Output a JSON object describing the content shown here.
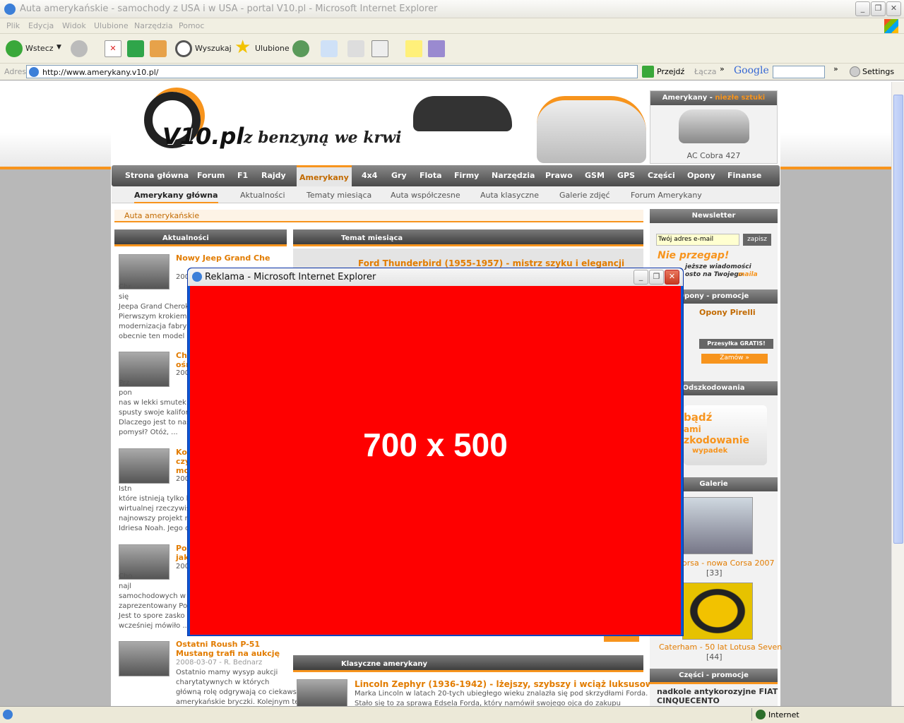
{
  "window": {
    "title": "Auta amerykańskie - samochody z USA i w USA - portal V10.pl - Microsoft Internet Explorer"
  },
  "menu": [
    "Plik",
    "Edycja",
    "Widok",
    "Ulubione",
    "Narzędzia",
    "Pomoc"
  ],
  "toolbar": {
    "back": "Wstecz",
    "search": "Wyszukaj",
    "favorites": "Ulubione"
  },
  "address": {
    "label": "Adres",
    "url": "http://www.amerykany.v10.pl/",
    "go": "Przejdź",
    "links": "Łącza",
    "google": "Google",
    "settings": "Settings"
  },
  "site": {
    "logo": "V10.pl",
    "slogan": "z benzyną we krwi",
    "promo": {
      "title": "Amerykany",
      "title_suffix": "niezłe sztuki",
      "caption": "AC Cobra 427"
    },
    "nav": [
      "Strona główna",
      "Forum",
      "F1",
      "Rajdy",
      "Amerykany",
      "4x4",
      "Gry",
      "Flota",
      "Firmy",
      "Narzędzia",
      "Prawo",
      "GSM",
      "GPS",
      "Części",
      "Opony",
      "Finanse"
    ],
    "subnav": [
      "Amerykany główna",
      "Aktualności",
      "Tematy miesiąca",
      "Auta współczesne",
      "Auta klasyczne",
      "Galerie zdjęć",
      "Forum Amerykany"
    ],
    "breadcrumb": "Auta amerykańskie",
    "news": {
      "header": "Aktualności",
      "items": [
        {
          "title": "Nowy Jeep Grand Che",
          "date": "200",
          "text": "Chr\nsię\nJeepa Grand Cherok\nPierwszym krokiem k\nmodernizacja fabryk\nobecnie ten model o"
        },
        {
          "title": "Ch\nośn",
          "date": "200",
          "text": "Prz\npon\nnas w lekki smutek. C\nspusty swoje kalifor\nDlaczego jest to nas\npomysł? Otóż, ..."
        },
        {
          "title": "Kon\nczy\nmo",
          "date": "200",
          "text": "Istn\nktóre istnieją tylko b\nwirtualnej rzeczywis\nnajnowszy projekt n\nIdriesa Noah. Jego c"
        },
        {
          "title": "Pon\njak",
          "date": "200",
          "text": "Cho\nnajl\nsamochodowych w N\nzaprezentowany Pon\nJest to spore zasko\nwcześniej mówiło ..."
        },
        {
          "title": "Ostatni Roush P-51\nMustang trafi na aukcję",
          "date": "2008-03-07 - R. Bednarz",
          "text": "Ostatnio mamy wysyp aukcji\ncharytatywnych w których\ngłówną rolę odgrywają co ciekawsze\namerykańskie bryczki. Kolejnym tego"
        }
      ]
    },
    "topic": {
      "header": "Temat miesiąca",
      "title": "Ford Thunderbird (1955-1957) - mistrz szyku i elegancji"
    },
    "classic": {
      "header": "Klasyczne amerykany",
      "title": "Lincoln Zephyr (1936-1942) - lżejszy, szybszy i wciąż luksusowy",
      "text": "Marka Lincoln w latach 20-tych ubiegłego wieku znalazła się pod skrzydłami Forda.\nStało się to za sprawą Edsela Forda, który namówił swojego ojca do zakupu"
    },
    "newsletter": {
      "header": "Newsletter",
      "placeholder": "Twój adres e-mail",
      "button": "zapisz",
      "promo1": "Nie przegap!",
      "promo2": "jeższe wiadomości\nosto na Twojego",
      "promo3": "maila"
    },
    "tires": {
      "header": "Opony - promocje",
      "title": "Opony Pirelli",
      "free": "Przesyłka GRATIS!",
      "order": "Zamów »"
    },
    "damages": {
      "header": "Odszkodowania",
      "l1": "bądź",
      "l2": "ami",
      "l3": "zkodowanie",
      "l4": "wypadek"
    },
    "gallery": {
      "header": "Galerie",
      "items": [
        {
          "caption": "orsa - nowa Corsa 2007",
          "count": "[33]"
        },
        {
          "caption": "Caterham - 50 lat Lotusa Seven",
          "count": "[44]"
        }
      ]
    },
    "parts": {
      "header": "Części - promocje",
      "title": "nadkole antykorozyjne FIAT\nCINQUECENTO"
    }
  },
  "popup": {
    "title": "Reklama - Microsoft Internet Explorer",
    "text": "700 x 500",
    "bg": "#fe0000"
  },
  "status": {
    "zone": "Internet"
  }
}
